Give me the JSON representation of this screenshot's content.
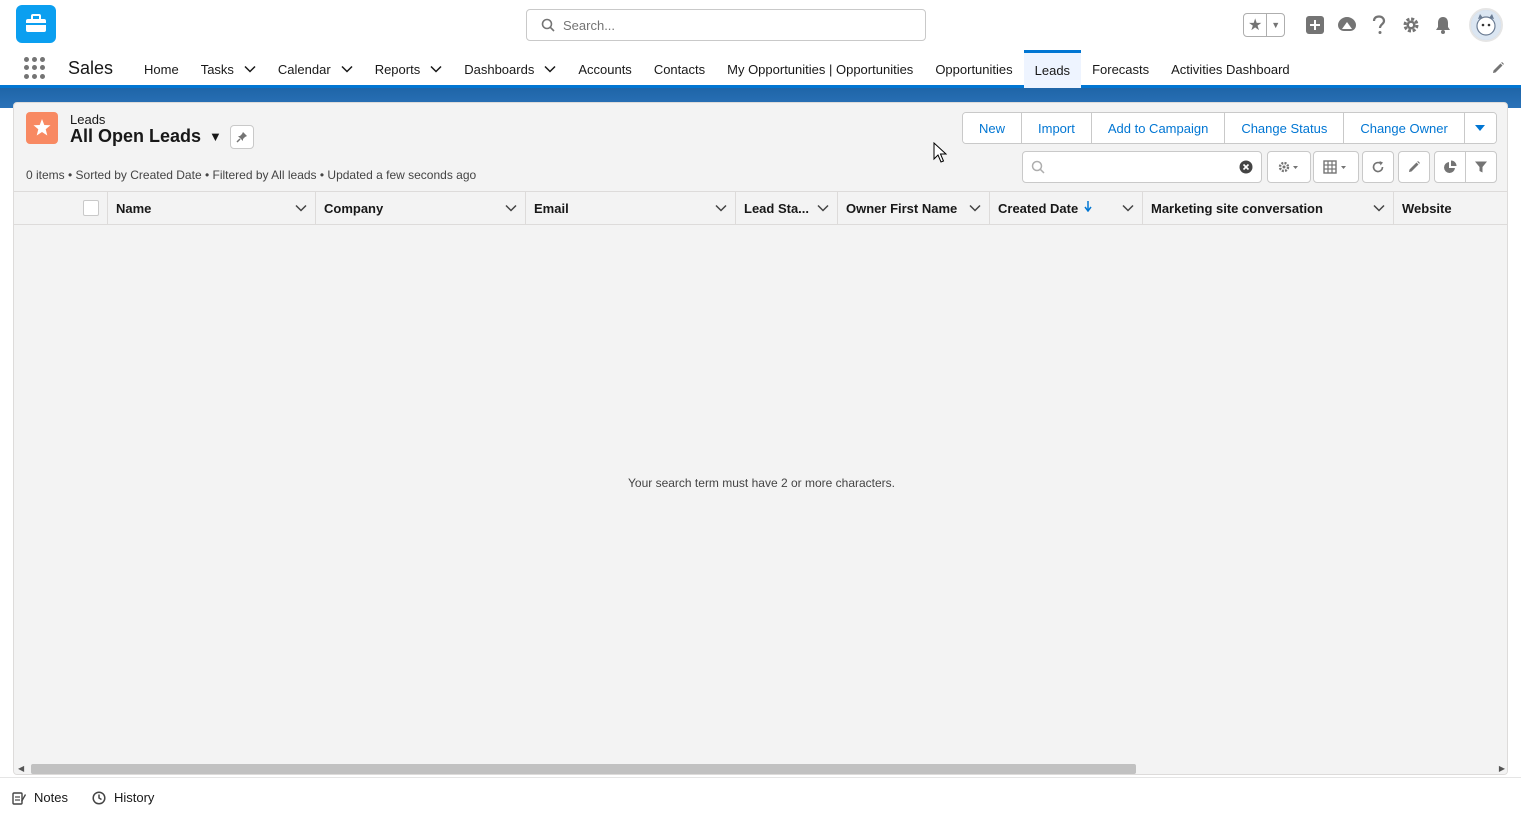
{
  "header": {
    "search_placeholder": "Search...",
    "icons": [
      "favorites-star-icon",
      "add-icon",
      "trailhead-icon",
      "help-icon",
      "setup-gear-icon",
      "notifications-bell-icon",
      "avatar"
    ]
  },
  "nav": {
    "app_name": "Sales",
    "items": [
      {
        "label": "Home",
        "dropdown": false
      },
      {
        "label": "Tasks",
        "dropdown": true
      },
      {
        "label": "Calendar",
        "dropdown": true
      },
      {
        "label": "Reports",
        "dropdown": true
      },
      {
        "label": "Dashboards",
        "dropdown": true
      },
      {
        "label": "Accounts",
        "dropdown": false
      },
      {
        "label": "Contacts",
        "dropdown": false
      },
      {
        "label": "My Opportunities | Opportunities",
        "dropdown": false
      },
      {
        "label": "Opportunities",
        "dropdown": false
      },
      {
        "label": "Leads",
        "dropdown": false,
        "active": true
      },
      {
        "label": "Forecasts",
        "dropdown": false
      },
      {
        "label": "Activities Dashboard",
        "dropdown": false
      }
    ]
  },
  "list_view": {
    "object_label": "Leads",
    "title": "All Open Leads",
    "meta": "0 items • Sorted by Created Date • Filtered by All leads • Updated a few seconds ago",
    "actions": [
      "New",
      "Import",
      "Add to Campaign",
      "Change Status",
      "Change Owner"
    ],
    "search_value": "",
    "columns": [
      {
        "label": "Name",
        "sorted": false
      },
      {
        "label": "Company",
        "sorted": false
      },
      {
        "label": "Email",
        "sorted": false
      },
      {
        "label": "Lead Sta...",
        "sorted": false
      },
      {
        "label": "Owner First Name",
        "sorted": false
      },
      {
        "label": "Created Date",
        "sorted": true
      },
      {
        "label": "Marketing site conversation",
        "sorted": false
      },
      {
        "label": "Website",
        "sorted": false
      }
    ],
    "empty_message": "Your search term must have 2 or more characters."
  },
  "utility_bar": {
    "items": [
      {
        "label": "Notes",
        "icon": "notes-icon"
      },
      {
        "label": "History",
        "icon": "history-clock-icon"
      }
    ]
  },
  "colors": {
    "brand_blue": "#0176d3",
    "lead_icon": "#f88962",
    "app_logo": "#0b9ff0"
  }
}
